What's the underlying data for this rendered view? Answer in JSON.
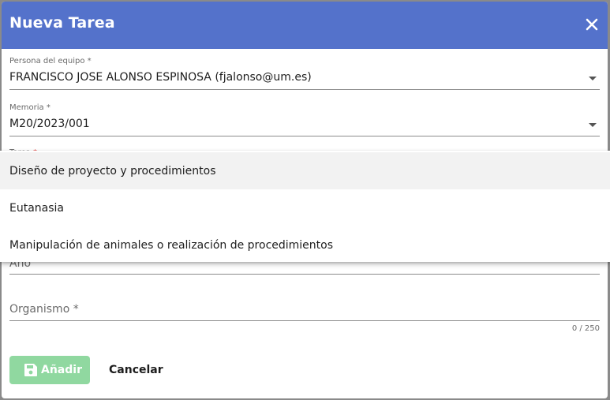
{
  "dialog": {
    "title": "Nueva Tarea",
    "close_icon": "close-icon"
  },
  "fields": {
    "persona": {
      "label": "Persona del equipo",
      "required": "*",
      "value": "FRANCISCO JOSE ALONSO ESPINOSA (fjalonso@um.es)"
    },
    "memoria": {
      "label": "Memoria",
      "required": "*",
      "value": "M20/2023/001"
    },
    "tarea": {
      "label": "Tarea",
      "required": "*"
    },
    "anio": {
      "label": "Año"
    },
    "organismo": {
      "label": "Organismo",
      "required": "*",
      "counter": "0 / 250"
    }
  },
  "dropdown": {
    "options": [
      "Diseño de proyecto y procedimientos",
      "Eutanasia",
      "Manipulación de animales o realización de procedimientos"
    ]
  },
  "actions": {
    "add_label": "Añadir",
    "add_icon": "save-icon",
    "cancel_label": "Cancelar"
  },
  "colors": {
    "header": "#5472cb",
    "add_button": "#90d8a0",
    "required_tarea": "#e53935"
  }
}
